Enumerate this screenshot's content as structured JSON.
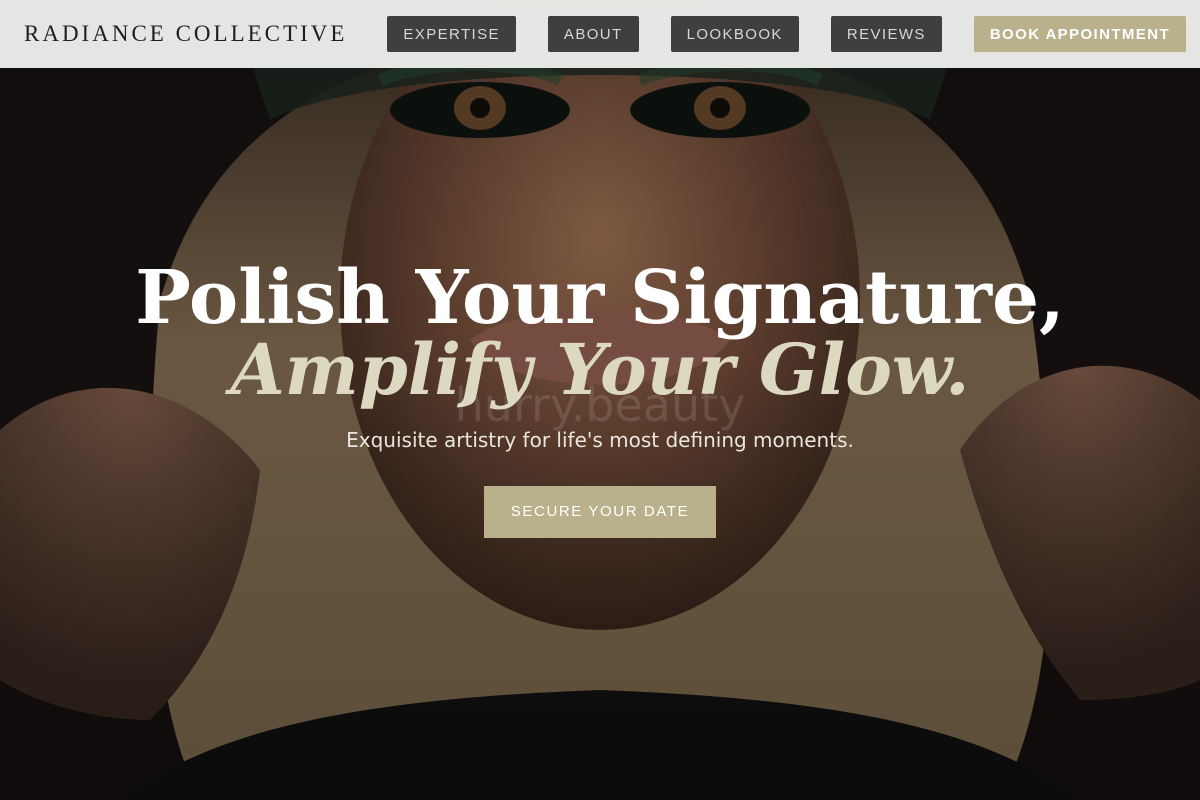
{
  "header": {
    "brand": "RADIANCE COLLECTIVE",
    "nav": [
      "EXPERTISE",
      "ABOUT",
      "LOOKBOOK",
      "REVIEWS"
    ],
    "cta": "BOOK APPOINTMENT"
  },
  "hero": {
    "headline_line1": "Polish Your Signature,",
    "headline_line2": "Amplify Your Glow.",
    "watermark": "hurry.beauty",
    "tagline": "Exquisite artistry for life's most defining moments.",
    "cta": "SECURE YOUR DATE"
  },
  "colors": {
    "accent": "#b8b18c",
    "nav_button": "#3f3f41",
    "header_bg": "#eeeeec"
  }
}
